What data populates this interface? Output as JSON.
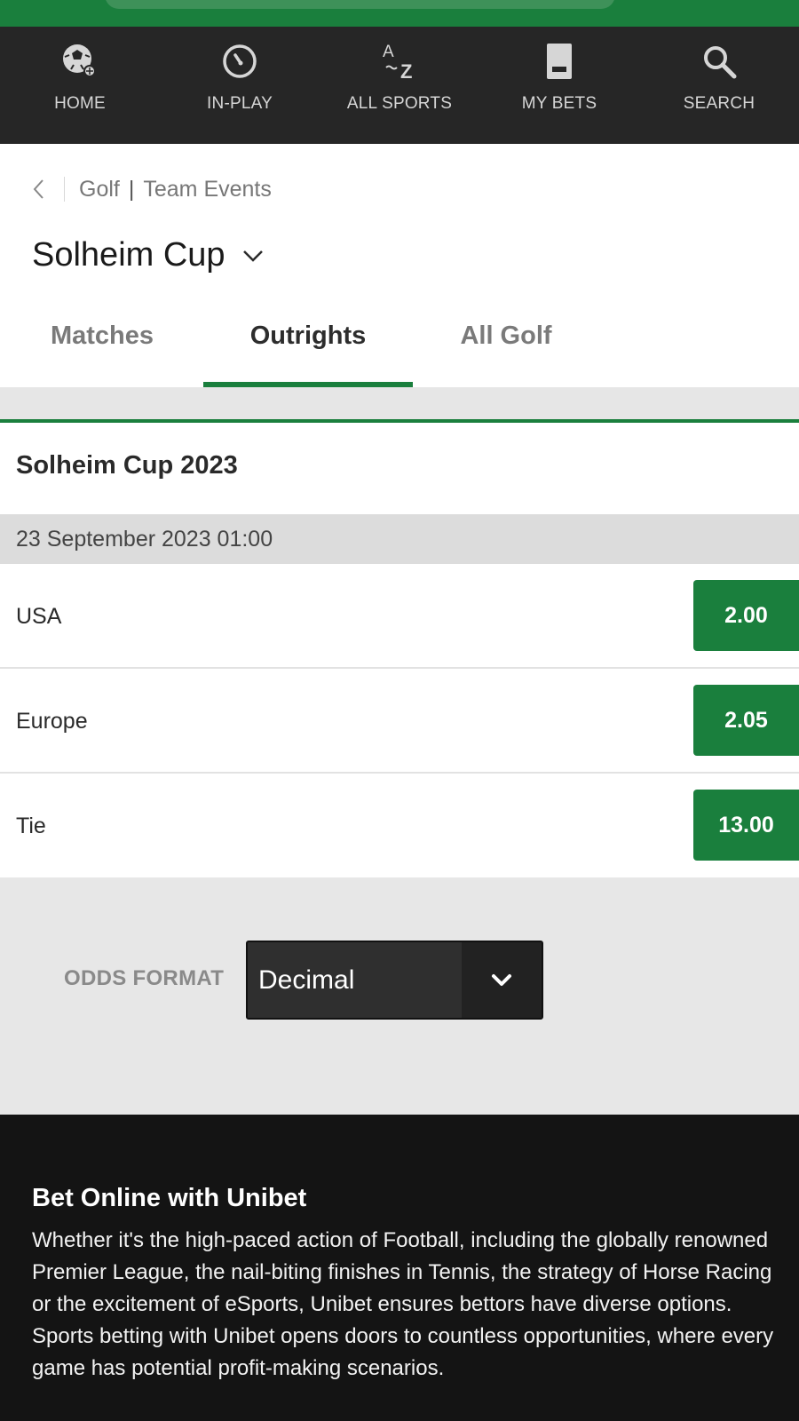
{
  "nav": {
    "items": [
      {
        "label": "HOME",
        "icon": "soccer-ball-icon"
      },
      {
        "label": "IN-PLAY",
        "icon": "stopwatch-icon"
      },
      {
        "label": "ALL SPORTS",
        "icon": "a-z-icon"
      },
      {
        "label": "MY BETS",
        "icon": "betslip-icon"
      },
      {
        "label": "SEARCH",
        "icon": "search-icon"
      }
    ]
  },
  "breadcrumb": {
    "sport": "Golf",
    "separator": "|",
    "category": "Team Events"
  },
  "event": {
    "title": "Solheim Cup"
  },
  "tabs": [
    {
      "label": "Matches",
      "active": false
    },
    {
      "label": "Outrights",
      "active": true
    },
    {
      "label": "All Golf",
      "active": false
    }
  ],
  "market": {
    "title": "Solheim Cup 2023",
    "date": "23 September 2023 01:00",
    "outcomes": [
      {
        "name": "USA",
        "odds": "2.00"
      },
      {
        "name": "Europe",
        "odds": "2.05"
      },
      {
        "name": "Tie",
        "odds": "13.00"
      }
    ]
  },
  "odds_format": {
    "label": "ODDS FORMAT",
    "value": "Decimal"
  },
  "footer": {
    "title": "Bet Online with Unibet",
    "text": "Whether it's the high-paced action of Football, including the globally renowned Premier League, the nail-biting finishes in Tennis, the strategy of Horse Racing or the excitement of eSports, Unibet ensures bettors have diverse options. Sports betting with Unibet opens doors to countless opportunities, where every game has potential profit-making scenarios."
  },
  "colors": {
    "brand_green": "#1a7f3d",
    "nav_bg": "#262626",
    "footer_bg": "#141414"
  }
}
